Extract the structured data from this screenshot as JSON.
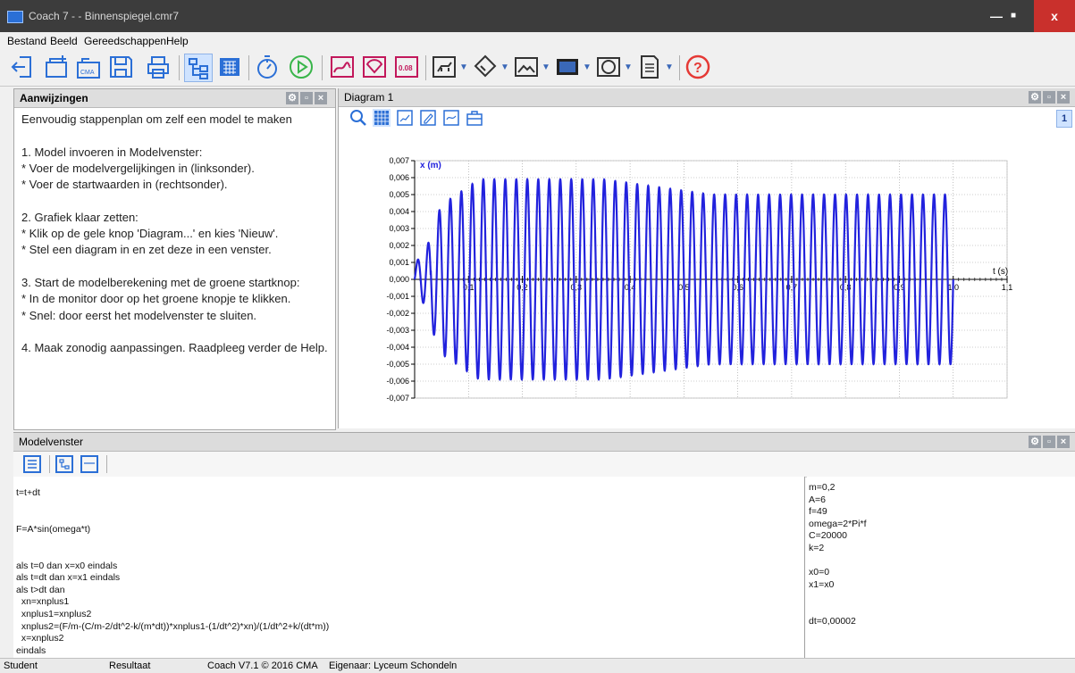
{
  "window": {
    "title": "Coach 7 -  - Binnenspiegel.cmr7",
    "minimize": "—",
    "maximize": "■",
    "close": "x"
  },
  "menu": [
    "Bestand",
    "Beeld",
    "Gereedschappen",
    "Help"
  ],
  "toolbar": {
    "cma_label": "CMA",
    "value_label": "0.08",
    "help_label": "?"
  },
  "aanwijzingen": {
    "title": "Aanwijzingen",
    "text": "Eenvoudig stappenplan om zelf een model te maken\n\n1. Model invoeren in Modelvenster:\n* Voer de modelvergelijkingen in (linksonder).\n* Voer de startwaarden in (rechtsonder).\n\n2. Grafiek klaar zetten:\n* Klik op de gele knop 'Diagram...' en kies 'Nieuw'.\n* Stel een diagram in en zet deze in een venster.\n\n3. Start de modelberekening met de groene startknop:\n* In de monitor door op het groene knopje te klikken.\n* Snel: door eerst het modelvenster te sluiten.\n\n4. Maak zonodig aanpassingen. Raadpleeg verder de Help."
  },
  "diagram": {
    "title": "Diagram 1",
    "page_number": "1"
  },
  "chart_data": {
    "type": "line",
    "ylabel": "x (m)",
    "xlabel": "t (s)",
    "xlim": [
      0,
      1.1
    ],
    "ylim": [
      -0.007,
      0.007
    ],
    "x_ticks": [
      "0,1",
      "0,2",
      "0,3",
      "0,4",
      "0,5",
      "0,6",
      "0,7",
      "0,8",
      "0,9",
      "1,0",
      "1,1"
    ],
    "y_ticks": [
      "0,007",
      "0,006",
      "0,005",
      "0,004",
      "0,003",
      "0,002",
      "0,001",
      "0,000",
      "-0,001",
      "-0,002",
      "-0,003",
      "-0,004",
      "-0,005",
      "-0,006",
      "-0,007"
    ],
    "grid": true,
    "color": "#2222dd",
    "series": [
      {
        "frequency_hz": 49,
        "steady_amplitude": 0.005,
        "peak_amplitude": 0.0059,
        "t_end": 1.0
      }
    ]
  },
  "model": {
    "title": "Modelvenster",
    "equations": "t=t+dt\n\n\nF=A*sin(omega*t)\n\n\nals t=0 dan x=x0 eindals\nals t=dt dan x=x1 eindals\nals t>dt dan\n  xn=xnplus1\n  xnplus1=xnplus2\n  xnplus2=(F/m-(C/m-2/dt^2-k/(m*dt))*xnplus1-(1/dt^2)*xn)/(1/dt^2+k/(dt*m))\n  x=xnplus2\neindals",
    "initial_values": "m=0,2\nA=6\nf=49\nomega=2*Pi*f\nC=20000\nk=2\n\nx0=0\nx1=x0\n\n\ndt=0,00002"
  },
  "status": {
    "user": "Student",
    "result": "Resultaat",
    "version": "Coach V7.1 © 2016 CMA",
    "owner": "Eigenaar: Lyceum Schondeln"
  }
}
